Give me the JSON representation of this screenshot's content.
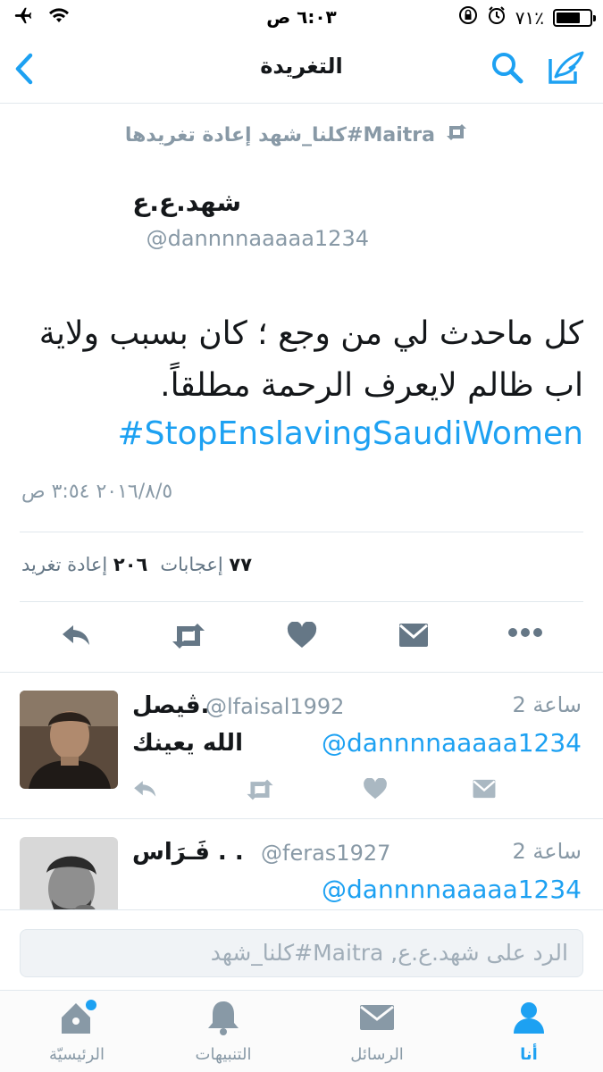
{
  "status_bar": {
    "time": "٦:٠٣ ص",
    "battery_percent": "٧١٪",
    "battery_level": 0.71
  },
  "nav": {
    "title": "التغريدة"
  },
  "tweet": {
    "retweeted_by": "Maitra#كلنا_شهد إعادة تغريدها",
    "author_name": "شهد.ع.ع",
    "author_handle": "@dannnnaaaaa1234",
    "body": "كل ماحدث لي من وجع ؛ كان بسبب ولاية اب ظالم لايعرف الرحمة مطلقاً.",
    "hashtag": "#StopEnslavingSaudiWomen",
    "date": "٢٠١٦/٨/٥ ٣:٥٤ ص",
    "likes_count": "٧٧",
    "likes_label": "إعجابات",
    "retweets_count": "٢٠٦",
    "retweets_label": "إعادة تغريد"
  },
  "replies": [
    {
      "name": "ڤيصل.",
      "handle": "@lfaisal1992",
      "time": "2 ساعة",
      "mention": "@dannnnaaaaa1234",
      "text": "الله يعينك"
    },
    {
      "name": "فَـرَاس . .",
      "handle": "@feras1927",
      "time": "2 ساعة",
      "mention": "@dannnnaaaaa1234",
      "text": ""
    }
  ],
  "reply_box": {
    "placeholder": "الرد على شهد.ع.ع, Maitra#كلنا_شهد"
  },
  "tabs": [
    {
      "label": "الرئيسيّة",
      "icon": "home-icon"
    },
    {
      "label": "التنبيهات",
      "icon": "bell-icon"
    },
    {
      "label": "الرسائل",
      "icon": "envelope-icon"
    },
    {
      "label": "أنا",
      "icon": "person-icon"
    }
  ],
  "colors": {
    "accent": "#1da1f2",
    "secondary_text": "#8899a6",
    "action_icon": "#657786"
  }
}
